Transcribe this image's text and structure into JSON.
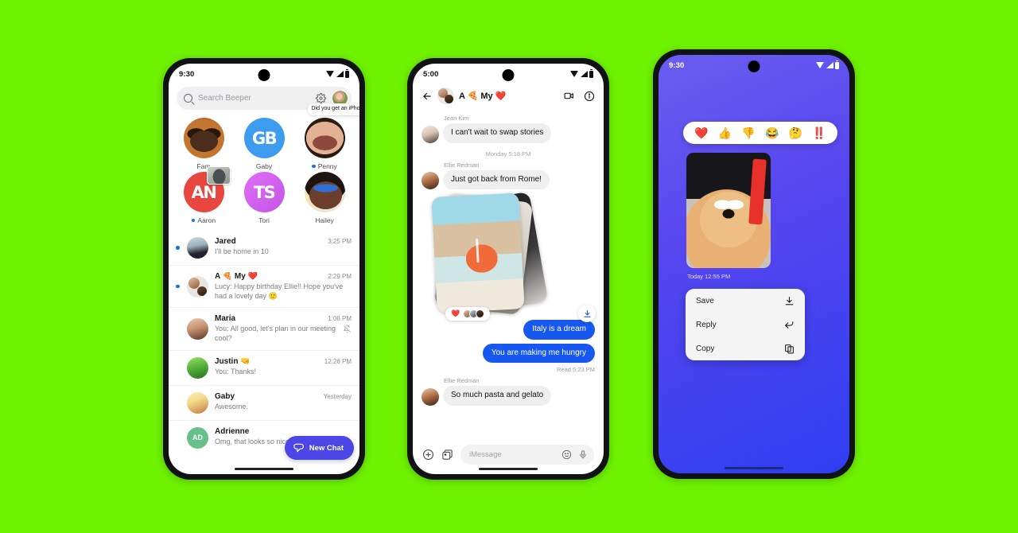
{
  "background_color": "#6EF200",
  "phone1": {
    "status_bar": {
      "time": "9:30",
      "icons": [
        "wifi-icon",
        "cellular-icon",
        "battery-icon"
      ]
    },
    "search": {
      "placeholder": "Search Beeper",
      "icon": "search-icon",
      "settings_icon": "gear-icon",
      "profile_icon": "avatar"
    },
    "pinned": [
      {
        "name": "Fam",
        "unread": false,
        "avatar": "dog-photo-avatar",
        "monogram": ""
      },
      {
        "name": "Gaby",
        "unread": false,
        "avatar": "monogram-avatar",
        "monogram": "GB"
      },
      {
        "name": "Penny",
        "unread": true,
        "avatar": "photo-avatar",
        "monogram": "",
        "speech_bubble": "Did you get\nan iPhone!?"
      },
      {
        "name": "Aaron",
        "unread": true,
        "avatar": "monogram-avatar",
        "monogram": "AN",
        "photo_badge": true
      },
      {
        "name": "Tori",
        "unread": false,
        "avatar": "monogram-avatar",
        "monogram": "TS"
      },
      {
        "name": "Hailey",
        "unread": false,
        "avatar": "photo-avatar",
        "monogram": ""
      }
    ],
    "chats": [
      {
        "name": "Jared",
        "time": "3:25 PM",
        "preview": "I'll be home in 10",
        "unread": true,
        "muted": false
      },
      {
        "name": "A 🍕 My ❤️",
        "time": "2:29 PM",
        "preview": "Lucy: Happy birthday Ellie!! Hope you've had a lovely day  🙂",
        "unread": true,
        "muted": false
      },
      {
        "name": "Maria",
        "time": "1:08 PM",
        "preview": "You: All good, let's plan in our meeting cool?",
        "unread": false,
        "muted": true
      },
      {
        "name": "Justin 🤜",
        "time": "12:26 PM",
        "preview": "You: Thanks!",
        "unread": false,
        "muted": false
      },
      {
        "name": "Gaby",
        "time": "Yesterday",
        "preview": "Awesome.",
        "unread": false,
        "muted": false
      },
      {
        "name": "Adrienne",
        "time": "",
        "preview": "Omg, that looks so nice!",
        "unread": false,
        "muted": false,
        "initials": "AD"
      }
    ],
    "fab": {
      "label": "New Chat",
      "icon": "chat-bubble-icon",
      "color": "#4b46e5"
    }
  },
  "phone2": {
    "status_bar": {
      "time": "5:00"
    },
    "header": {
      "title": "A 🍕 My ❤️",
      "back_icon": "back-arrow-icon",
      "video_icon": "video-call-icon",
      "info_icon": "info-icon"
    },
    "messages": [
      {
        "type": "incoming",
        "sender": "Jean Kim",
        "text": "I can't wait to swap stories"
      },
      {
        "type": "daystamp",
        "text": "Monday 5:18 PM"
      },
      {
        "type": "incoming",
        "sender": "Ellie Redman",
        "text": "Just got back from Rome!"
      },
      {
        "type": "photo-stack",
        "reaction": "❤️",
        "reaction_count_avatars": 3,
        "download_icon": "download-icon"
      },
      {
        "type": "outgoing",
        "text": "Italy is a dream"
      },
      {
        "type": "outgoing",
        "text": "You are making me hungry"
      },
      {
        "type": "read-receipt",
        "text": "Read  5:23 PM"
      },
      {
        "type": "incoming",
        "sender": "Ellie Redman",
        "text": "So much pasta and gelato"
      }
    ],
    "composer": {
      "placeholder": "iMessage",
      "plus_icon": "plus-icon",
      "photos_icon": "photos-icon",
      "emoji_icon": "emoji-icon",
      "mic_icon": "microphone-icon"
    }
  },
  "phone3": {
    "status_bar": {
      "time": "9:30"
    },
    "background_color": "#5646ef",
    "reactions": [
      "❤️",
      "👍",
      "👎",
      "😂",
      "🤔",
      "‼️"
    ],
    "photo": {
      "alt": "dog-with-sunglasses-photo"
    },
    "timestamp": "Today  12:55 PM",
    "context_menu": [
      {
        "label": "Save",
        "icon": "download-icon"
      },
      {
        "label": "Reply",
        "icon": "reply-arrow-icon"
      },
      {
        "label": "Copy",
        "icon": "copy-icon"
      }
    ]
  }
}
